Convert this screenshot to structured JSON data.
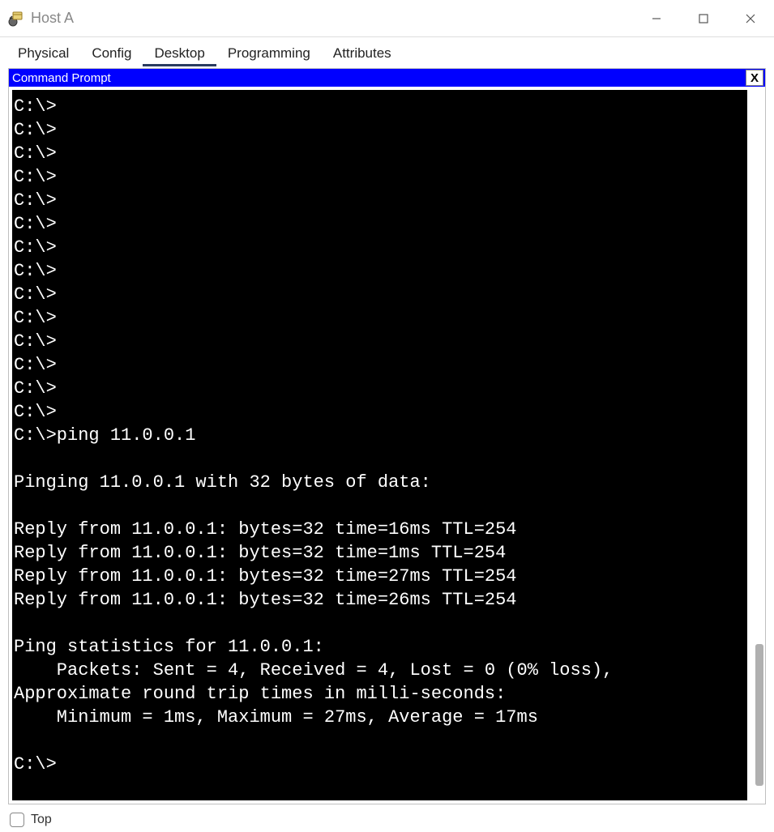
{
  "window": {
    "title": "Host A",
    "sysbuttons": {
      "minimize": "minimize",
      "maximize": "maximize",
      "close": "close"
    }
  },
  "tabs": {
    "items": [
      "Physical",
      "Config",
      "Desktop",
      "Programming",
      "Attributes"
    ],
    "active_index": 2
  },
  "command_prompt": {
    "title": "Command Prompt",
    "close_label": "X",
    "lines": [
      "C:\\>",
      "C:\\>",
      "C:\\>",
      "C:\\>",
      "C:\\>",
      "C:\\>",
      "C:\\>",
      "C:\\>",
      "C:\\>",
      "C:\\>",
      "C:\\>",
      "C:\\>",
      "C:\\>",
      "C:\\>",
      "C:\\>ping 11.0.0.1",
      "",
      "Pinging 11.0.0.1 with 32 bytes of data:",
      "",
      "Reply from 11.0.0.1: bytes=32 time=16ms TTL=254",
      "Reply from 11.0.0.1: bytes=32 time=1ms TTL=254",
      "Reply from 11.0.0.1: bytes=32 time=27ms TTL=254",
      "Reply from 11.0.0.1: bytes=32 time=26ms TTL=254",
      "",
      "Ping statistics for 11.0.0.1:",
      "    Packets: Sent = 4, Received = 4, Lost = 0 (0% loss),",
      "Approximate round trip times in milli-seconds:",
      "    Minimum = 1ms, Maximum = 27ms, Average = 17ms",
      "",
      "C:\\>"
    ]
  },
  "bottom": {
    "top_checkbox_label": "Top",
    "top_checked": false
  }
}
